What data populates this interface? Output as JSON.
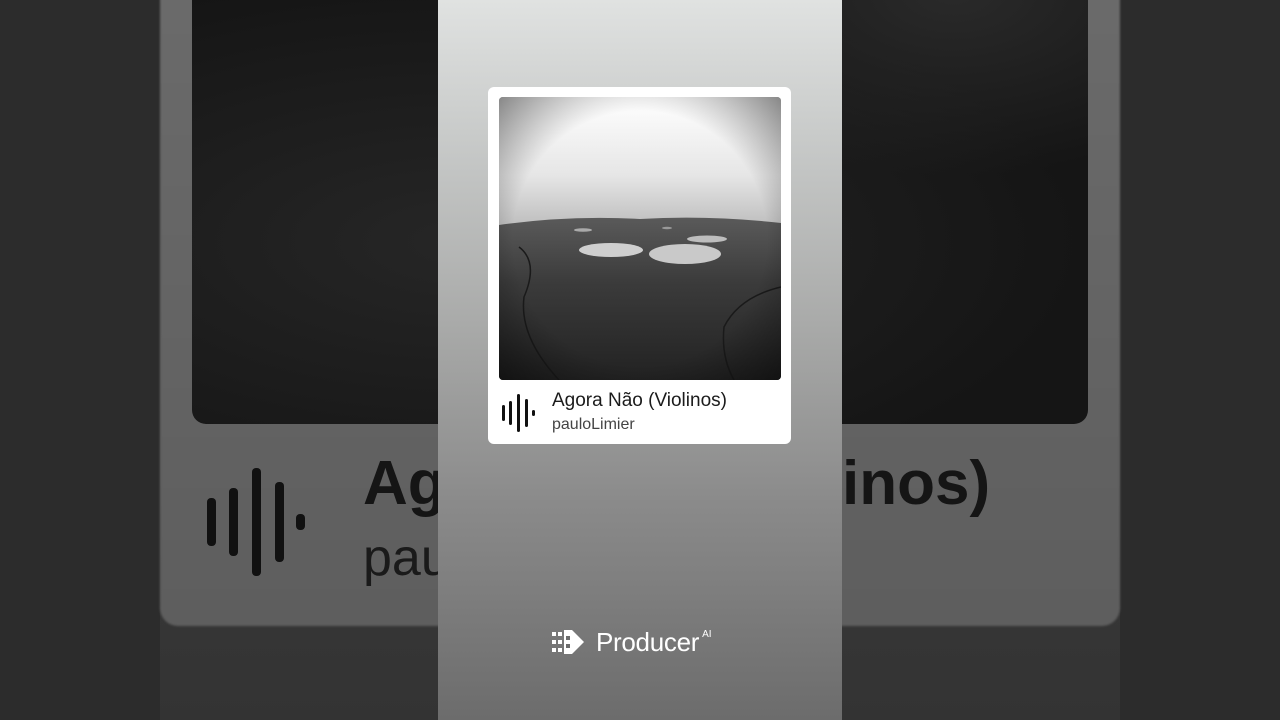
{
  "track": {
    "title": "Agora Não (Violinos)",
    "artist": "pauloLimier"
  },
  "background": {
    "title_visible_left": "Ag",
    "title_visible_right": "inos)",
    "artist_visible": "pau"
  },
  "brand": {
    "name": "Producer",
    "superscript": "AI"
  },
  "icons": {
    "waveform": "audio-waveform-icon",
    "brand_logo": "producer-logo-icon"
  },
  "colors": {
    "card_bg": "#ffffff",
    "text_primary": "#1b1b1b",
    "text_secondary": "#444444",
    "brand_text": "#ffffff"
  }
}
